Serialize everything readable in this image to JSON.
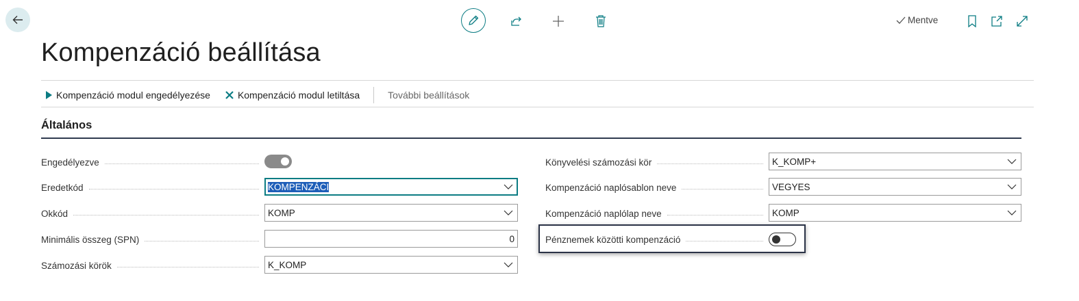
{
  "header": {
    "back_icon": "arrow-left-icon",
    "toolbar_icons": [
      "edit-pencil-icon",
      "share-icon",
      "plus-icon",
      "trash-icon"
    ],
    "saved_label": "Mentve",
    "right_icons": [
      "bookmark-icon",
      "open-new-window-icon",
      "expand-icon"
    ]
  },
  "page": {
    "title": "Kompenzáció beállítása"
  },
  "actions": {
    "enable_label": "Kompenzáció modul engedélyezése",
    "disable_label": "Kompenzáció modul letiltása",
    "more_label": "További beállítások"
  },
  "section": {
    "title": "Általános"
  },
  "left_fields": {
    "enabled": {
      "label": "Engedélyezve",
      "value": true
    },
    "source_code": {
      "label": "Eredetkód",
      "value": "KOMPENZÁCI"
    },
    "reason_code": {
      "label": "Okkód",
      "value": "KOMP"
    },
    "min_amount": {
      "label": "Minimális összeg (SPN)",
      "value": "0"
    },
    "number_series": {
      "label": "Számozási körök",
      "value": "K_KOMP"
    }
  },
  "right_fields": {
    "posting_series": {
      "label": "Könyvelési számozási kör",
      "value": "K_KOMP+"
    },
    "template_name": {
      "label": "Kompenzáció naplósablon neve",
      "value": "VEGYES"
    },
    "batch_name": {
      "label": "Kompenzáció naplólap neve",
      "value": "KOMP"
    },
    "cross_currency": {
      "label": "Pénznemek közötti kompenzáció",
      "value": false
    }
  },
  "colors": {
    "accent": "#0b7c83",
    "selection": "#1e5eb8",
    "section_rule": "#2f3a4f"
  }
}
